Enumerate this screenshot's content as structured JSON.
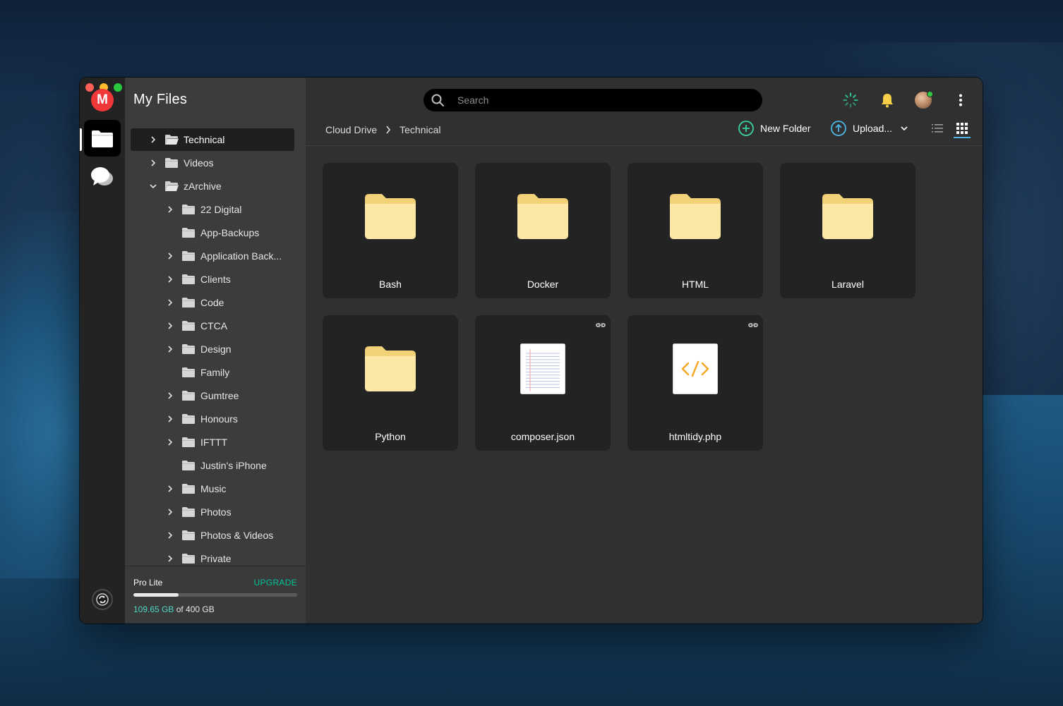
{
  "window": {
    "title": "My Files"
  },
  "rail": {
    "logo_letter": "M",
    "items": [
      {
        "name": "cloud-drive-icon",
        "active": true
      },
      {
        "name": "chat-icon",
        "active": false
      }
    ],
    "bottom_icon": "sync-status-icon"
  },
  "sidebar": {
    "title": "My Files",
    "tree": [
      {
        "label": "Technical",
        "level": 0,
        "chevron": "right",
        "selected": true
      },
      {
        "label": "Videos",
        "level": 0,
        "chevron": "right",
        "selected": false
      },
      {
        "label": "zArchive",
        "level": 0,
        "chevron": "down",
        "selected": false
      },
      {
        "label": "22 Digital",
        "level": 1,
        "chevron": "right",
        "selected": false
      },
      {
        "label": "App-Backups",
        "level": 1,
        "chevron": "none",
        "selected": false
      },
      {
        "label": "Application Back...",
        "level": 1,
        "chevron": "right",
        "selected": false
      },
      {
        "label": "Clients",
        "level": 1,
        "chevron": "right",
        "selected": false
      },
      {
        "label": "Code",
        "level": 1,
        "chevron": "right",
        "selected": false
      },
      {
        "label": "CTCA",
        "level": 1,
        "chevron": "right",
        "selected": false
      },
      {
        "label": "Design",
        "level": 1,
        "chevron": "right",
        "selected": false
      },
      {
        "label": "Family",
        "level": 1,
        "chevron": "none",
        "selected": false
      },
      {
        "label": "Gumtree",
        "level": 1,
        "chevron": "right",
        "selected": false
      },
      {
        "label": "Honours",
        "level": 1,
        "chevron": "right",
        "selected": false
      },
      {
        "label": "IFTTT",
        "level": 1,
        "chevron": "right",
        "selected": false
      },
      {
        "label": "Justin's iPhone",
        "level": 1,
        "chevron": "none",
        "selected": false
      },
      {
        "label": "Music",
        "level": 1,
        "chevron": "right",
        "selected": false
      },
      {
        "label": "Photos",
        "level": 1,
        "chevron": "right",
        "selected": false
      },
      {
        "label": "Photos & Videos",
        "level": 1,
        "chevron": "right",
        "selected": false
      },
      {
        "label": "Private",
        "level": 1,
        "chevron": "right",
        "selected": false
      }
    ],
    "storage": {
      "plan": "Pro Lite",
      "upgrade_label": "UPGRADE",
      "used": "109.65 GB",
      "of_total": " of 400 GB",
      "used_fraction": 0.274
    }
  },
  "toolbar": {
    "search_placeholder": "Search",
    "icons": [
      "transfer-progress-icon",
      "notifications-bell-icon",
      "avatar",
      "more-menu-icon"
    ]
  },
  "breadcrumb": [
    "Cloud Drive",
    "Technical"
  ],
  "actions": {
    "new_folder_label": "New Folder",
    "upload_label": "Upload...",
    "view_mode": "grid"
  },
  "items": [
    {
      "name": "Bash",
      "type": "folder",
      "shared_link": false
    },
    {
      "name": "Docker",
      "type": "folder",
      "shared_link": false
    },
    {
      "name": "HTML",
      "type": "folder",
      "shared_link": false
    },
    {
      "name": "Laravel",
      "type": "folder",
      "shared_link": false
    },
    {
      "name": "Python",
      "type": "folder",
      "shared_link": false
    },
    {
      "name": "composer.json",
      "type": "text-file",
      "shared_link": true
    },
    {
      "name": "htmltidy.php",
      "type": "code-file",
      "shared_link": true
    }
  ],
  "colors": {
    "accent_teal": "#00c398",
    "used_teal": "#4fd6c2",
    "folder_yellow": "#fbe7a6",
    "code_orange": "#f5a623",
    "logo_red": "#f0373a",
    "view_active_blue": "#4fb6e4"
  }
}
